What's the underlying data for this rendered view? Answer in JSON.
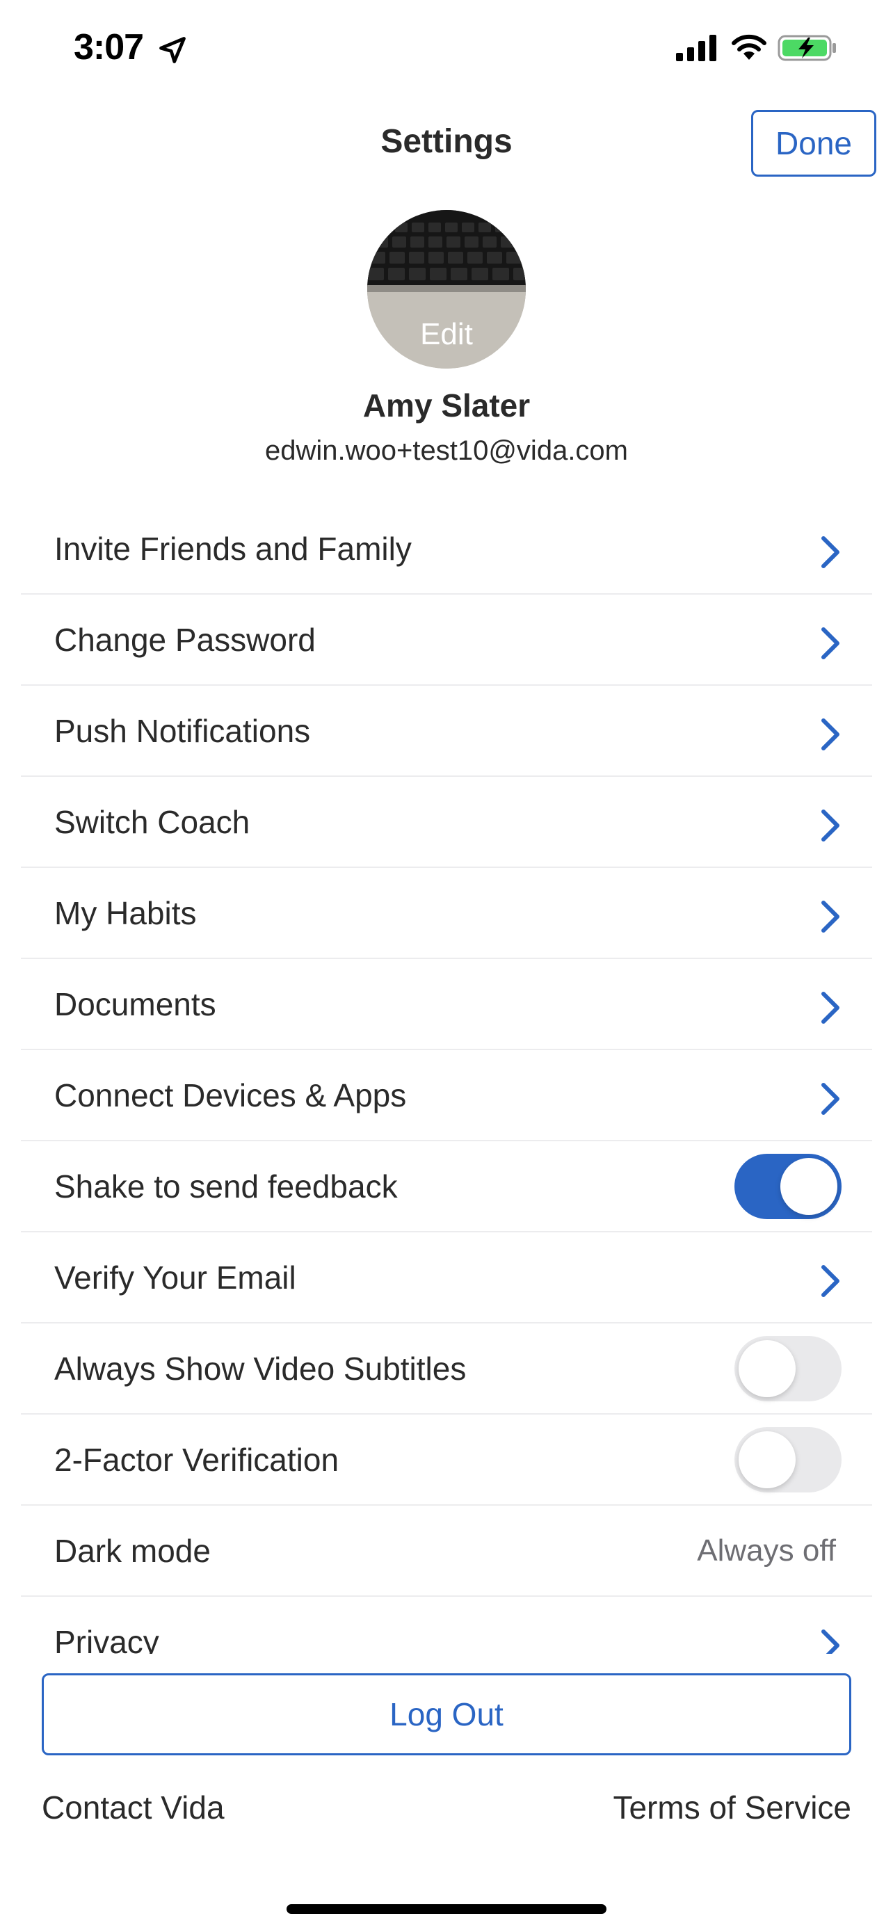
{
  "status_bar": {
    "time": "3:07",
    "icons": [
      "location-arrow-icon",
      "cellular-signal-icon",
      "wifi-icon",
      "battery-charging-icon"
    ]
  },
  "header": {
    "title": "Settings",
    "done_label": "Done"
  },
  "profile": {
    "avatar_edit_label": "Edit",
    "name": "Amy Slater",
    "email": "edwin.woo+test10@vida.com"
  },
  "settings": {
    "items": [
      {
        "label": "Invite Friends and Family",
        "control": "chevron"
      },
      {
        "label": "Change Password",
        "control": "chevron"
      },
      {
        "label": "Push Notifications",
        "control": "chevron"
      },
      {
        "label": "Switch Coach",
        "control": "chevron"
      },
      {
        "label": "My Habits",
        "control": "chevron"
      },
      {
        "label": "Documents",
        "control": "chevron"
      },
      {
        "label": "Connect Devices & Apps",
        "control": "chevron"
      },
      {
        "label": "Shake to send feedback",
        "control": "toggle",
        "on": true
      },
      {
        "label": "Verify Your Email",
        "control": "chevron"
      },
      {
        "label": "Always Show Video Subtitles",
        "control": "toggle",
        "on": false
      },
      {
        "label": "2-Factor Verification",
        "control": "toggle",
        "on": false
      },
      {
        "label": "Dark mode",
        "control": "value",
        "value": "Always off"
      },
      {
        "label": "Privacy",
        "control": "chevron"
      }
    ]
  },
  "actions": {
    "logout_label": "Log Out"
  },
  "footer": {
    "contact_label": "Contact Vida",
    "terms_label": "Terms of Service"
  },
  "colors": {
    "accent": "#2a65c4",
    "toggle_off": "#e9e9eb",
    "separator": "#ececee",
    "text": "#2a2a2a",
    "secondary_text": "#6e6e73"
  }
}
